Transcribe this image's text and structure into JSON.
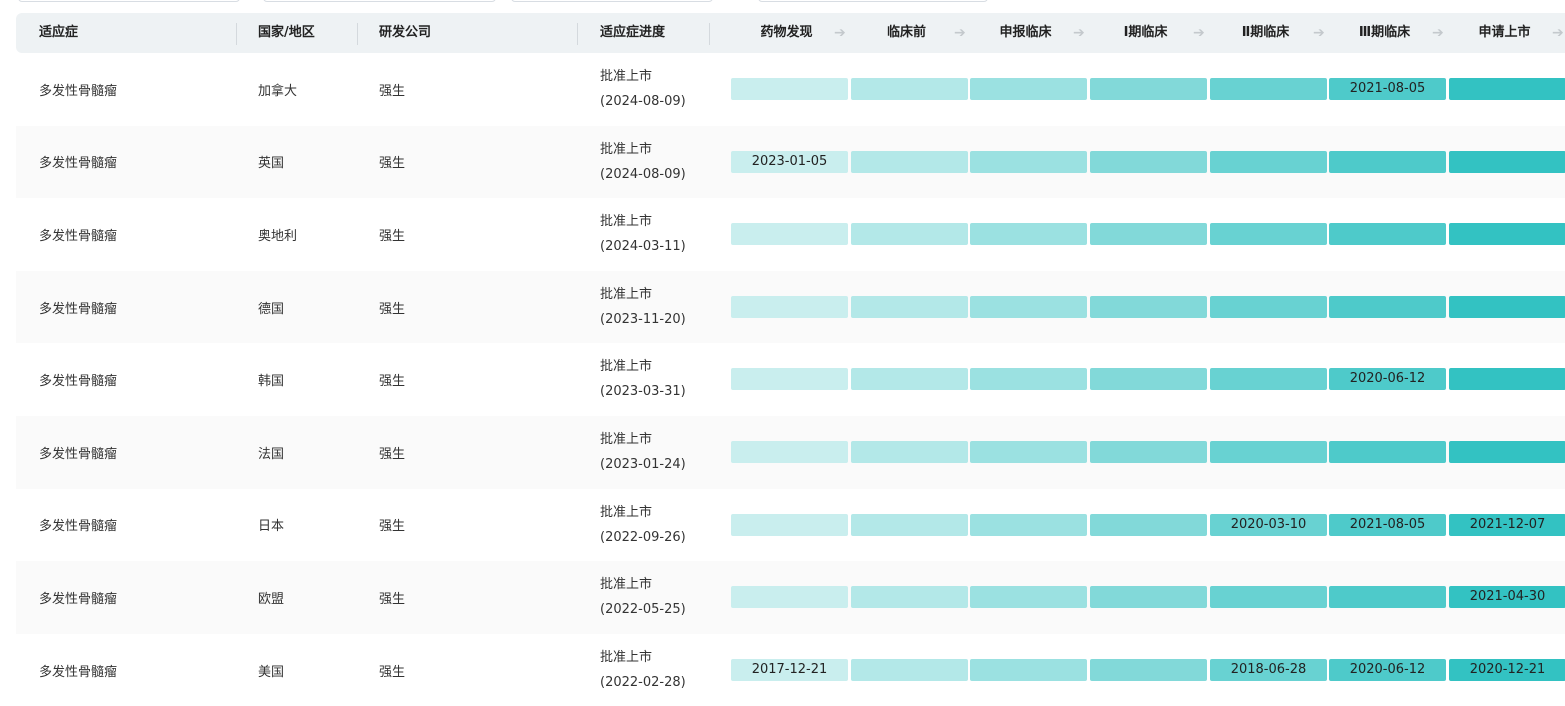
{
  "header": {
    "indication": "适应症",
    "country": "国家/地区",
    "company": "研发公司",
    "progress": "适应症进度"
  },
  "stages": [
    "药物发现",
    "临床前",
    "申报临床",
    "Ⅰ期临床",
    "Ⅱ期临床",
    "Ⅲ期临床",
    "申请上市"
  ],
  "stage_colors": [
    "#c9eeee",
    "#b3e8e8",
    "#9be1e1",
    "#82d9d9",
    "#68d2d2",
    "#4ecaca",
    "#33c2c2"
  ],
  "rows": [
    {
      "indication": "多发性骨髓瘤",
      "country": "加拿大",
      "company": "强生",
      "status": "批准上市",
      "date": "(2024-08-09)",
      "stage_dates": [
        "",
        "",
        "",
        "",
        "",
        "2021-08-05",
        ""
      ]
    },
    {
      "indication": "多发性骨髓瘤",
      "country": "英国",
      "company": "强生",
      "status": "批准上市",
      "date": "(2024-08-09)",
      "stage_dates": [
        "2023-01-05",
        "",
        "",
        "",
        "",
        "",
        ""
      ]
    },
    {
      "indication": "多发性骨髓瘤",
      "country": "奥地利",
      "company": "强生",
      "status": "批准上市",
      "date": "(2024-03-11)",
      "stage_dates": [
        "",
        "",
        "",
        "",
        "",
        "",
        ""
      ]
    },
    {
      "indication": "多发性骨髓瘤",
      "country": "德国",
      "company": "强生",
      "status": "批准上市",
      "date": "(2023-11-20)",
      "stage_dates": [
        "",
        "",
        "",
        "",
        "",
        "",
        ""
      ]
    },
    {
      "indication": "多发性骨髓瘤",
      "country": "韩国",
      "company": "强生",
      "status": "批准上市",
      "date": "(2023-03-31)",
      "stage_dates": [
        "",
        "",
        "",
        "",
        "",
        "2020-06-12",
        ""
      ]
    },
    {
      "indication": "多发性骨髓瘤",
      "country": "法国",
      "company": "强生",
      "status": "批准上市",
      "date": "(2023-01-24)",
      "stage_dates": [
        "",
        "",
        "",
        "",
        "",
        "",
        ""
      ]
    },
    {
      "indication": "多发性骨髓瘤",
      "country": "日本",
      "company": "强生",
      "status": "批准上市",
      "date": "(2022-09-26)",
      "stage_dates": [
        "",
        "",
        "",
        "",
        "2020-03-10",
        "2021-08-05",
        "2021-12-07"
      ]
    },
    {
      "indication": "多发性骨髓瘤",
      "country": "欧盟",
      "company": "强生",
      "status": "批准上市",
      "date": "(2022-05-25)",
      "stage_dates": [
        "",
        "",
        "",
        "",
        "",
        "",
        "2021-04-30"
      ]
    },
    {
      "indication": "多发性骨髓瘤",
      "country": "美国",
      "company": "强生",
      "status": "批准上市",
      "date": "(2022-02-28)",
      "stage_dates": [
        "2017-12-21",
        "",
        "",
        "",
        "2018-06-28",
        "2020-06-12",
        "2020-12-21"
      ]
    }
  ]
}
